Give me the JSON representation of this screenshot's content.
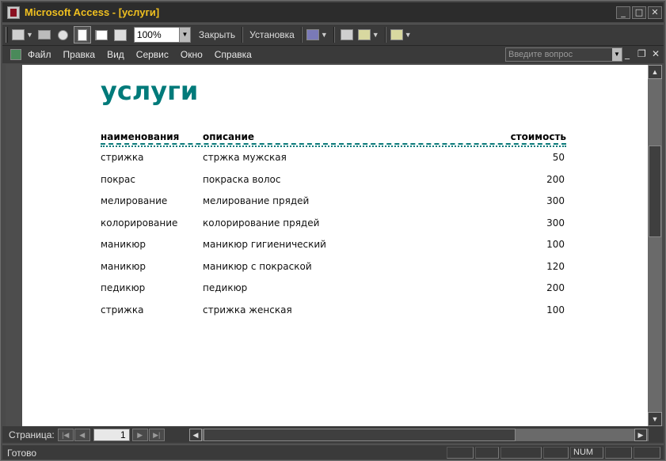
{
  "window": {
    "title": "Microsoft Access - [услуги]"
  },
  "toolbar": {
    "zoom_value": "100%",
    "close_label": "Закрыть",
    "setup_label": "Установка"
  },
  "menu": {
    "items": [
      "Файл",
      "Правка",
      "Вид",
      "Сервис",
      "Окно",
      "Справка"
    ],
    "ask_placeholder": "Введите вопрос"
  },
  "report": {
    "title": "услуги",
    "headers": {
      "name": "наименования",
      "description": "описание",
      "price": "стоимость"
    },
    "rows": [
      {
        "name": "стрижка",
        "description": "стржка мужская",
        "price": "50"
      },
      {
        "name": "покрас",
        "description": "покраска волос",
        "price": "200"
      },
      {
        "name": "мелирование",
        "description": "мелирование прядей",
        "price": "300"
      },
      {
        "name": "колорирование",
        "description": "колорирование прядей",
        "price": "300"
      },
      {
        "name": "маникюр",
        "description": "маникюр гигиенический",
        "price": "100"
      },
      {
        "name": "маникюр",
        "description": "маникюр с покраской",
        "price": "120"
      },
      {
        "name": "педикюр",
        "description": "педикюр",
        "price": "200"
      },
      {
        "name": "стрижка",
        "description": "стрижка женская",
        "price": "100"
      }
    ]
  },
  "navigation": {
    "page_label": "Страница:",
    "page_number": "1"
  },
  "status": {
    "text": "Готово",
    "num": "NUM"
  },
  "colors": {
    "accent": "#007a7a",
    "title_text": "#f0c020"
  }
}
